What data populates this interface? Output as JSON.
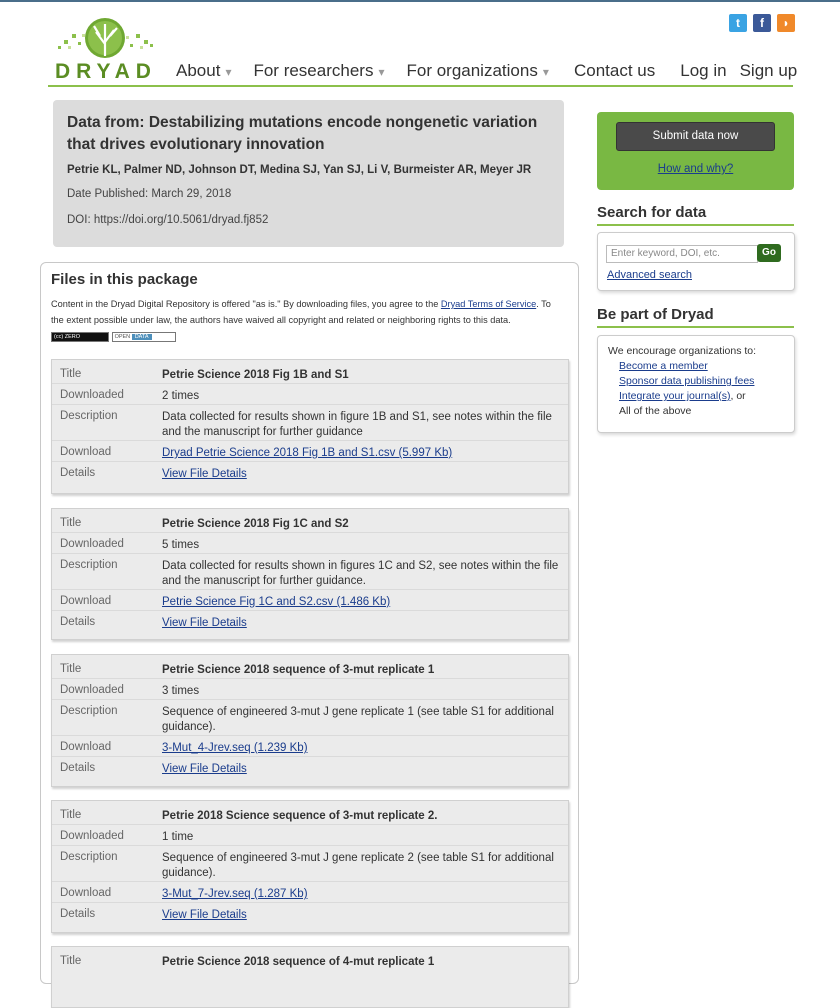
{
  "header": {
    "logo_text": "DRYAD",
    "nav": [
      {
        "label": "About"
      },
      {
        "label": "For researchers"
      },
      {
        "label": "For organizations"
      }
    ],
    "nav_right": {
      "contact": "Contact us",
      "login": "Log in",
      "signup": "Sign up"
    },
    "social": {
      "twitter": "t",
      "facebook": "f",
      "rss": "rss"
    }
  },
  "citation": {
    "title": "Data from: Destabilizing mutations encode nongenetic variation that drives evolutionary innovation",
    "authors": "Petrie KL, Palmer ND, Johnson DT, Medina SJ, Yan SJ, Li V, Burmeister AR, Meyer JR",
    "date": "Date Published: March 29, 2018",
    "doi": "DOI: https://doi.org/10.5061/dryad.fj852"
  },
  "files": {
    "heading": "Files in this package",
    "notice_pre": "Content in the Dryad Digital Repository is offered \"as is.\" By downloading files, you agree to the ",
    "notice_link1": "Dryad Terms of Service",
    "notice_post": ". To the extent possible under law, the authors have waived all copyright and related or neighboring rights to this data.",
    "badge_cc": "ZERO",
    "badge_od_left": "OPEN",
    "badge_od_right": "DATA",
    "labels": {
      "title": "Title",
      "downloaded": "Downloaded",
      "description": "Description",
      "download": "Download",
      "details": "Details"
    },
    "items": [
      {
        "title": "Petrie Science 2018 Fig 1B and S1",
        "downloaded": "2 times",
        "description": "Data collected for results shown in figure 1B and S1, see notes within the file and the manuscript for further guidance",
        "download": "Dryad Petrie Science 2018 Fig 1B and S1.csv (5.997 Kb)",
        "details": "View File Details"
      },
      {
        "title": "Petrie Science 2018 Fig 1C and S2",
        "downloaded": "5 times",
        "description": "Data collected for results shown in figures 1C and S2, see notes within the file and the manuscript for further guidance.",
        "download": "Petrie Science Fig 1C and S2.csv (1.486 Kb)",
        "details": "View File Details"
      },
      {
        "title": "Petrie Science 2018 sequence of 3-mut replicate 1",
        "downloaded": "3 times",
        "description": "Sequence of engineered 3-mut J gene replicate 1 (see table S1 for additional guidance).",
        "download": "3-Mut_4-Jrev.seq (1.239 Kb)",
        "details": "View File Details"
      },
      {
        "title": "Petrie 2018 Science sequence of 3-mut replicate 2.",
        "downloaded": "1 time",
        "description": "Sequence of engineered 3-mut J gene replicate 2 (see table S1 for additional guidance).",
        "download": "3-Mut_7-Jrev.seq (1.287 Kb)",
        "details": "View File Details"
      },
      {
        "title": "Petrie Science 2018 sequence of 4-mut replicate 1"
      }
    ]
  },
  "sidebar": {
    "submit_button": "Submit data now",
    "how_why": "How and why?",
    "search_heading": "Search for data",
    "search_placeholder": "Enter keyword, DOI, etc.",
    "go_button": "Go",
    "advanced_search": "Advanced search",
    "bepart_heading": "Be part of Dryad",
    "bepart_intro": "We encourage organizations to:",
    "bepart_link1": "Become a member",
    "bepart_link2": "Sponsor data publishing fees",
    "bepart_link3": "Integrate your journal(s)",
    "bepart_or": ", or",
    "bepart_all": "All of the above"
  }
}
